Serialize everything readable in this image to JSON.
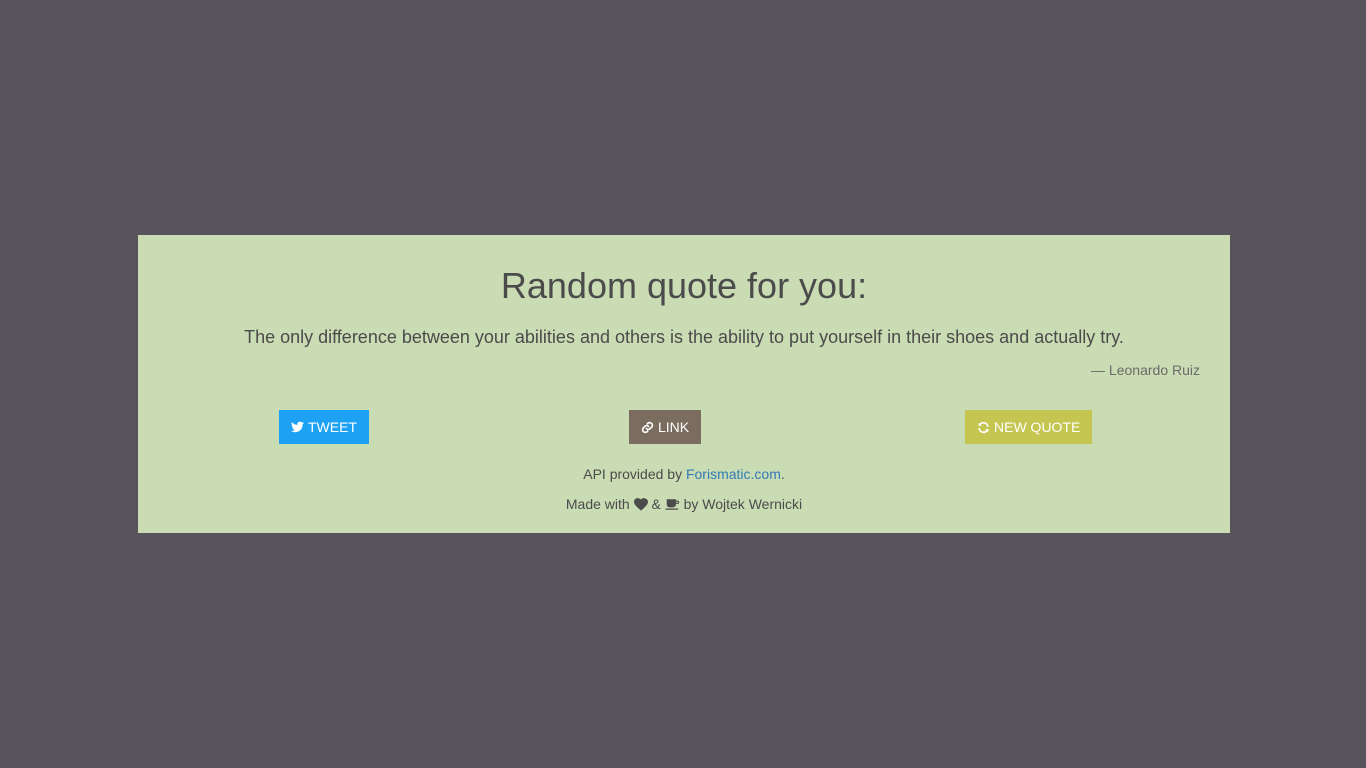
{
  "header": {
    "title": "Random quote for you:"
  },
  "quote": {
    "text": "The only difference between your abilities and others is the ability to put yourself in their shoes and actually try.",
    "author": "— Leonardo Ruiz"
  },
  "buttons": {
    "tweet": {
      "label": "TWEET",
      "icon": "twitter-icon",
      "color": "#1da1f2"
    },
    "link": {
      "label": "LINK",
      "icon": "link-icon",
      "color": "#7a6d60"
    },
    "new_quote": {
      "label": "NEW QUOTE",
      "icon": "refresh-icon",
      "color": "#c5c552"
    }
  },
  "footer": {
    "api_prefix": "API provided by ",
    "api_link_text": "Forismatic.com",
    "api_suffix": ".",
    "made_prefix": "Made with",
    "made_amp": "&",
    "made_suffix": "by Wojtek Wernicki",
    "heart_icon": "heart-icon",
    "coffee_icon": "coffee-icon"
  },
  "colors": {
    "background": "#56545a",
    "card": "#c9dcb3",
    "link": "#337ab7"
  }
}
